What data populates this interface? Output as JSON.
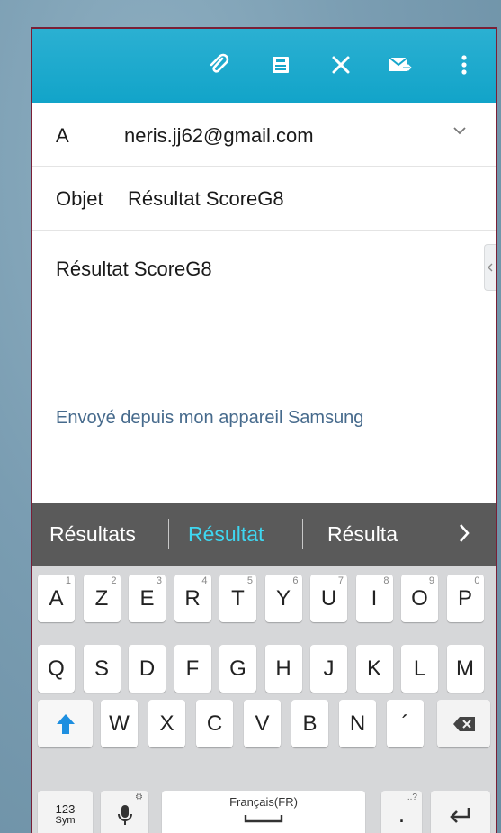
{
  "toolbar": {
    "icons": [
      "paperclip-icon",
      "save-icon",
      "close-icon",
      "send-icon",
      "more-icon"
    ],
    "color": "#16a6cb"
  },
  "to": {
    "label": "A",
    "value": "neris.jj62@gmail.com"
  },
  "subject": {
    "label": "Objet",
    "value": "Résultat ScoreG8"
  },
  "body": {
    "text": "Résultat ScoreG8",
    "signature": "Envoyé depuis mon appareil Samsung"
  },
  "suggestions": {
    "items": [
      "Résultats",
      "Résultat",
      "Résulta"
    ],
    "active_color": "#3fd6f0"
  },
  "keyboard": {
    "row1": [
      {
        "k": "A",
        "h": "1"
      },
      {
        "k": "Z",
        "h": "2"
      },
      {
        "k": "E",
        "h": "3"
      },
      {
        "k": "R",
        "h": "4"
      },
      {
        "k": "T",
        "h": "5"
      },
      {
        "k": "Y",
        "h": "6"
      },
      {
        "k": "U",
        "h": "7"
      },
      {
        "k": "I",
        "h": "8"
      },
      {
        "k": "O",
        "h": "9"
      },
      {
        "k": "P",
        "h": "0"
      }
    ],
    "row2": [
      "Q",
      "S",
      "D",
      "F",
      "G",
      "H",
      "J",
      "K",
      "L",
      "M"
    ],
    "row3": [
      "W",
      "X",
      "C",
      "V",
      "B",
      "N",
      "´"
    ],
    "sym_main": "123",
    "sym_sub": "Sym",
    "mic_hint": "⚙",
    "space_label": "Français(FR)",
    "period_hint": "..?",
    "period": "."
  }
}
